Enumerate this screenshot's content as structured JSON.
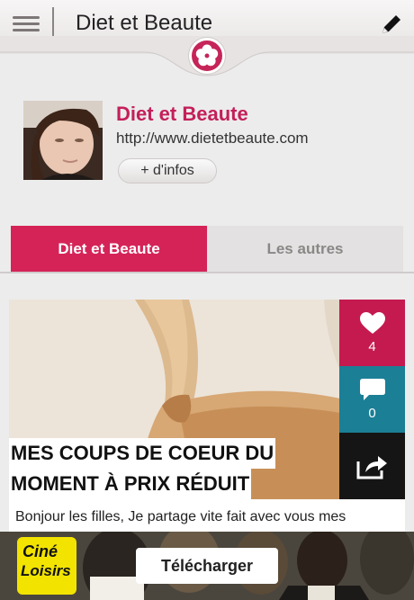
{
  "header": {
    "title": "Diet et Beaute"
  },
  "profile": {
    "name": "Diet et Beaute",
    "url": "http://www.dietetbeaute.com",
    "more_label": "+ d'infos"
  },
  "tabs": [
    {
      "label": "Diet et Beaute",
      "active": true
    },
    {
      "label": "Les autres",
      "active": false
    }
  ],
  "post": {
    "title_line1": "MES COUPS DE COEUR DU",
    "title_line2": "MOMENT À PRIX RÉDUIT",
    "excerpt": "Bonjour les filles, Je partage vite fait avec vous mes",
    "likes": "4",
    "comments": "0"
  },
  "ad": {
    "logo_line1": "Ciné",
    "logo_line2": "Loisirs",
    "button_label": "Télécharger"
  },
  "colors": {
    "accent": "#d52358",
    "like": "#c41a4f",
    "comment": "#1b7f96",
    "share": "#151515"
  },
  "icons": [
    "menu-icon",
    "edit-pencil-icon",
    "flower-icon",
    "heart-icon",
    "comment-icon",
    "share-icon"
  ]
}
